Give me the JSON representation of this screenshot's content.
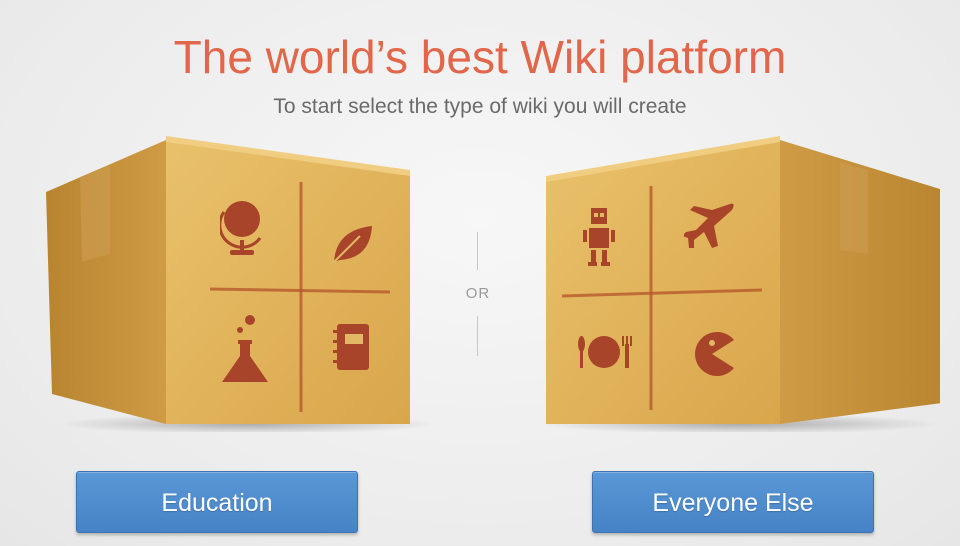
{
  "header": {
    "title": "The world’s best Wiki platform",
    "subtitle": "To start select the type of wiki you will create"
  },
  "separator": {
    "label": "OR"
  },
  "education": {
    "icons": [
      "globe-icon",
      "leaf-icon",
      "flask-icon",
      "notebook-icon"
    ],
    "button_label": "Education"
  },
  "everyone_else": {
    "icons": [
      "robot-icon",
      "airplane-icon",
      "plate-cutlery-icon",
      "pacman-icon"
    ],
    "button_label": "Everyone Else"
  },
  "colors": {
    "title": "#e2664a",
    "subtitle": "#6a6a6a",
    "button": "#4a8bcd",
    "box": "#dcae58",
    "stamp": "#a8442a"
  }
}
